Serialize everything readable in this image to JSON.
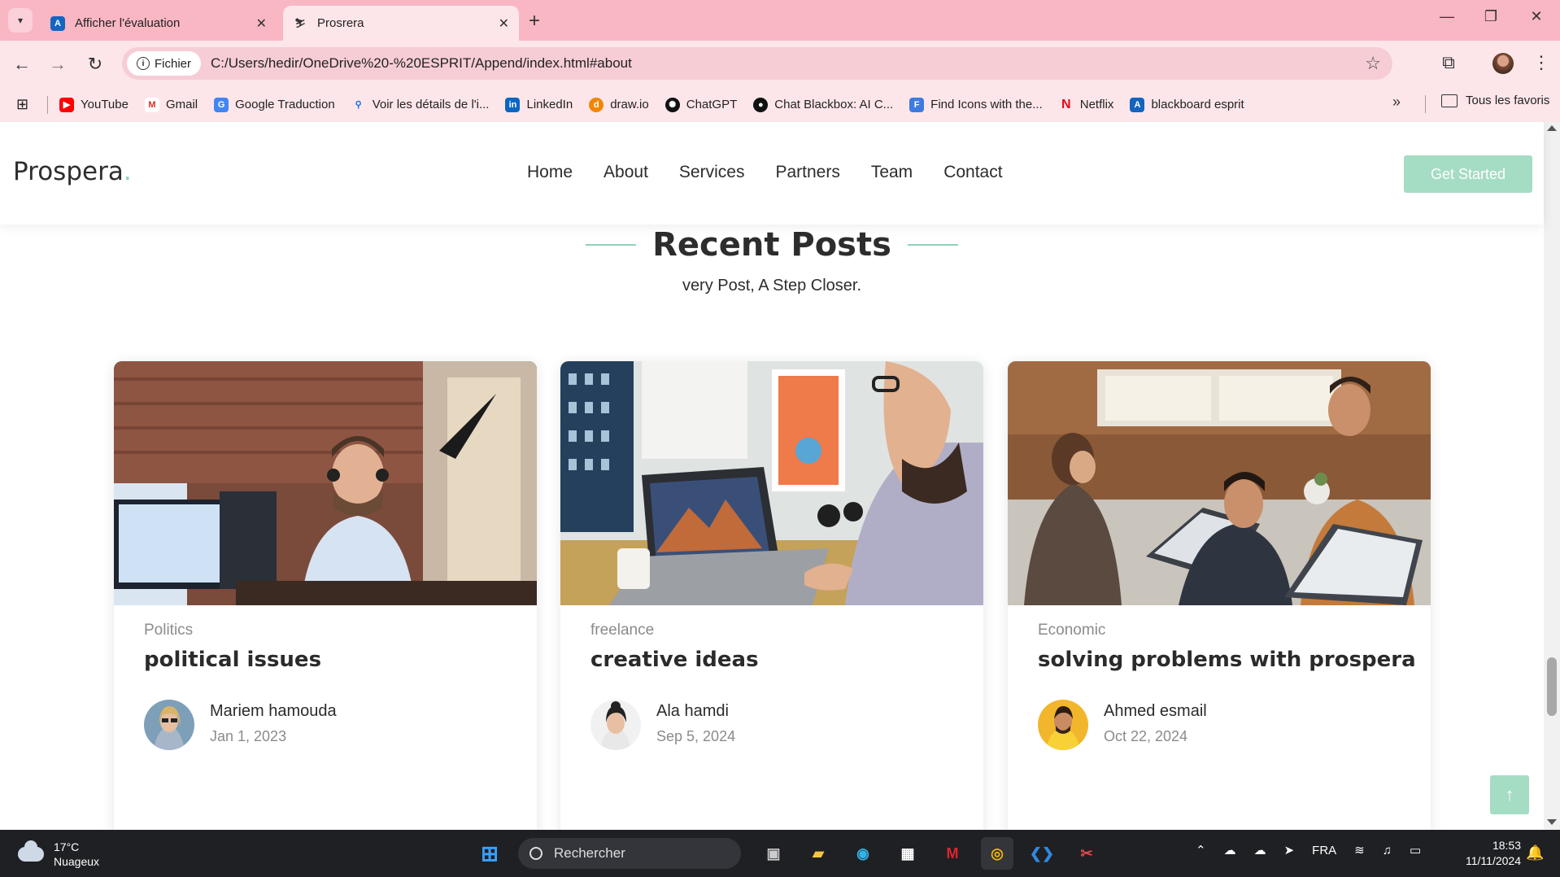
{
  "browser": {
    "tabs": [
      {
        "title": "Afficher l'évaluation",
        "favicon": "A",
        "favicon_color": "#1565c0"
      },
      {
        "title": "Prosrera",
        "favicon": "P",
        "favicon_color": "#555555"
      }
    ],
    "address": {
      "chip": "Fichier",
      "url": "C:/Users/hedir/OneDrive%20-%20ESPRIT/Append/index.html#about"
    },
    "bookmarks": [
      {
        "label": "YouTube",
        "icon": "youtube-icon",
        "color": "#ff0000",
        "glyph": "▶"
      },
      {
        "label": "Gmail",
        "icon": "gmail-icon",
        "color": "#d93025",
        "glyph": "M"
      },
      {
        "label": "Google Traduction",
        "icon": "translate-icon",
        "color": "#4285f4",
        "glyph": "G"
      },
      {
        "label": "Voir les détails de l'i...",
        "icon": "search-icon",
        "color": "#1a73e8",
        "glyph": "Q"
      },
      {
        "label": "LinkedIn",
        "icon": "linkedin-icon",
        "color": "#0a66c2",
        "glyph": "in"
      },
      {
        "label": "draw.io",
        "icon": "drawio-icon",
        "color": "#f08705",
        "glyph": "d"
      },
      {
        "label": "ChatGPT",
        "icon": "chatgpt-icon",
        "color": "#111111",
        "glyph": "✺"
      },
      {
        "label": "Chat Blackbox: AI C...",
        "icon": "blackbox-icon",
        "color": "#111111",
        "glyph": "●"
      },
      {
        "label": "Find Icons with the...",
        "icon": "flaticon-icon",
        "color": "#3d7be0",
        "glyph": "F"
      },
      {
        "label": "Netflix",
        "icon": "netflix-icon",
        "color": "#e50914",
        "glyph": "N"
      },
      {
        "label": "blackboard esprit",
        "icon": "blackboard-icon",
        "color": "#1565c0",
        "glyph": "A"
      }
    ],
    "all_bookmarks": "Tous les favoris"
  },
  "site": {
    "logo": "Prospera",
    "logo_dot": ".",
    "nav": [
      "Home",
      "About",
      "Services",
      "Partners",
      "Team",
      "Contact"
    ],
    "cta": "Get Started",
    "accent": "#a5dcc4"
  },
  "section": {
    "title": "Recent Posts",
    "subtitle": "very Post, A Step Closer."
  },
  "posts": [
    {
      "category": "Politics",
      "title": "political issues",
      "author": "Mariem hamouda",
      "date": "Jan 1, 2023"
    },
    {
      "category": "freelance",
      "title": "creative ideas",
      "author": "Ala hamdi",
      "date": "Sep 5, 2024"
    },
    {
      "category": "Economic",
      "title": "solving problems with prospera",
      "author": "Ahmed esmail",
      "date": "Oct 22, 2024"
    }
  ],
  "taskbar": {
    "weather_temp": "17°C",
    "weather_desc": "Nuageux",
    "search_placeholder": "Rechercher",
    "lang": "FRA",
    "time": "18:53",
    "date": "11/11/2024"
  }
}
